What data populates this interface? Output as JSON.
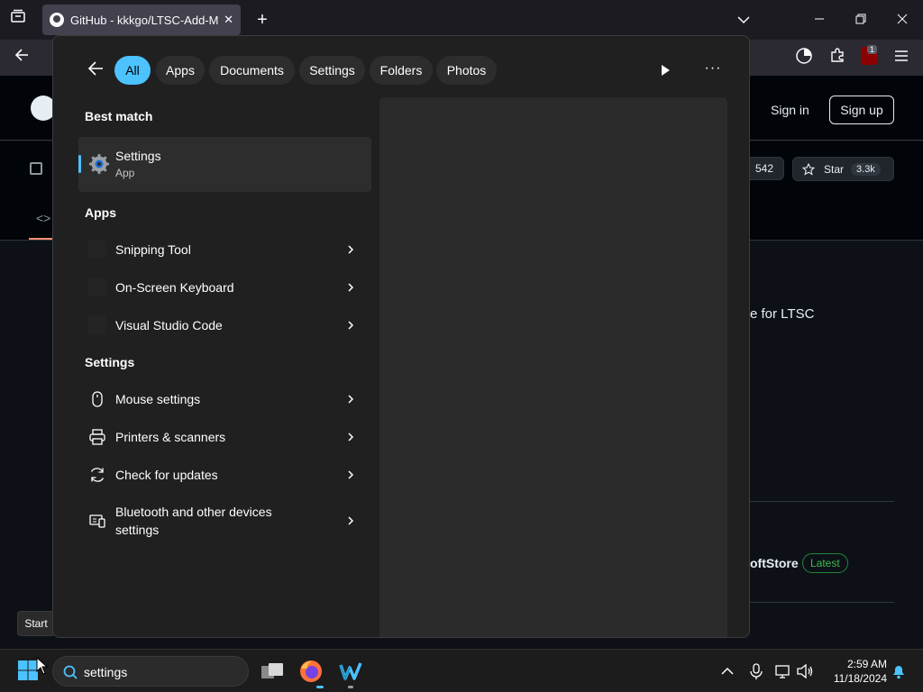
{
  "browser": {
    "tab_title": "GitHub - kkkgo/LTSC-Add-Mic",
    "tab_close": "✕",
    "new_tab": "+",
    "ublock_badge": "1"
  },
  "github": {
    "sign_in": "Sign in",
    "sign_up": "Sign up",
    "fork_count": "542",
    "star_label": "Star",
    "star_count": "3.3k",
    "description_fragment": "e for LTSC",
    "release_fragment": "oftStore",
    "release_badge": "Latest"
  },
  "tooltip": {
    "start": "Start"
  },
  "flyout": {
    "filters": [
      "All",
      "Apps",
      "Documents",
      "Settings",
      "Folders",
      "Photos"
    ],
    "active_filter": "All",
    "more_label": "···",
    "best_match_heading": "Best match",
    "best_match": {
      "name": "Settings",
      "type": "App",
      "icon": "gear-icon"
    },
    "apps_heading": "Apps",
    "apps": [
      {
        "label": "Snipping Tool"
      },
      {
        "label": "On-Screen Keyboard"
      },
      {
        "label": "Visual Studio Code"
      }
    ],
    "settings_heading": "Settings",
    "settings": [
      {
        "label": "Mouse settings",
        "icon": "mouse-icon"
      },
      {
        "label": "Printers & scanners",
        "icon": "printer-icon"
      },
      {
        "label": "Check for updates",
        "icon": "update-icon"
      },
      {
        "label_line1": "Bluetooth and other devices",
        "label_line2": "settings",
        "icon": "bluetooth-devices-icon"
      }
    ]
  },
  "taskbar": {
    "search_value": "settings",
    "time": "2:59 AM",
    "date": "11/18/2024"
  },
  "colors": {
    "accent": "#4cc2ff",
    "flyout_bg": "#202020",
    "github_bg": "#0d1117"
  }
}
